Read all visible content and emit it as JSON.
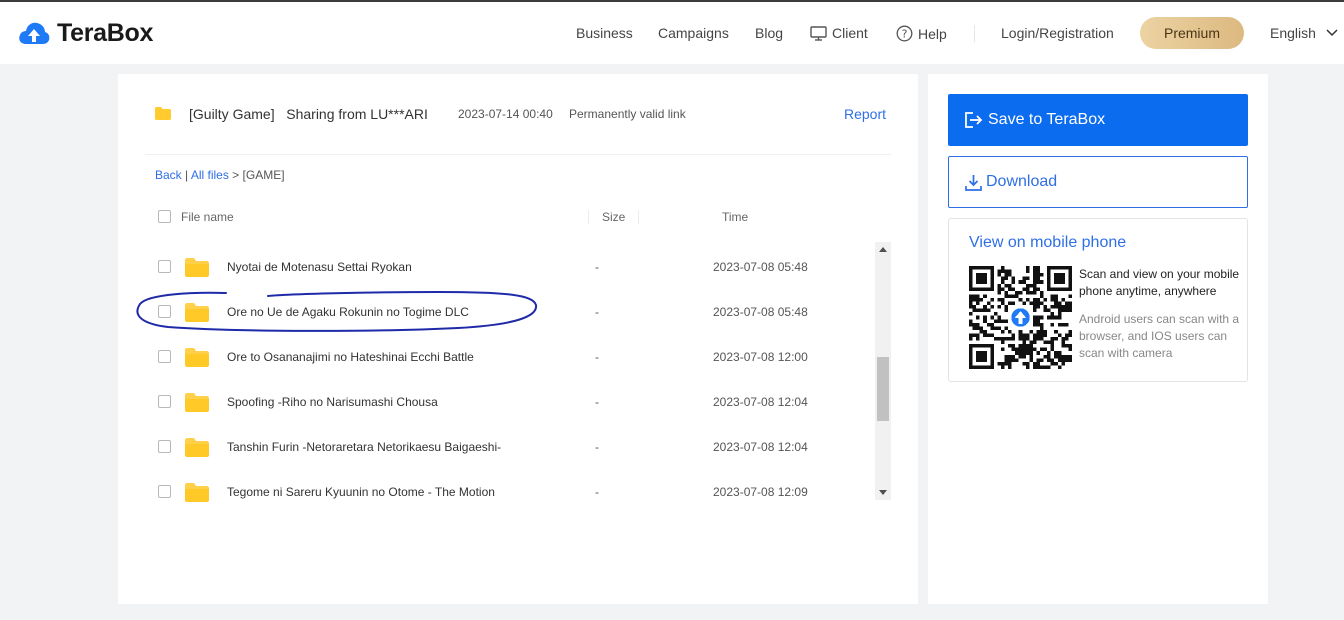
{
  "header": {
    "brand": "TeraBox",
    "nav": {
      "business": "Business",
      "campaigns": "Campaigns",
      "blog": "Blog",
      "client": "Client",
      "help": "Help",
      "login": "Login/Registration",
      "premium": "Premium",
      "language": "English"
    }
  },
  "share": {
    "title": "[Guilty Game]   Sharing from LU***ARI",
    "date": "2023-07-14 00:40",
    "validity": "Permanently valid link",
    "report": "Report"
  },
  "breadcrumb": {
    "back": "Back",
    "sep": "|",
    "all_files": "All files",
    "current": " > [GAME]"
  },
  "table": {
    "columns": {
      "name": "File name",
      "size": "Size",
      "time": "Time"
    },
    "rows": [
      {
        "name": "Nyotai de Motenasu Settai Ryokan",
        "size": "-",
        "time": "2023-07-08 05:48"
      },
      {
        "name": "Ore no Ue de Agaku Rokunin no Togime DLC",
        "size": "-",
        "time": "2023-07-08 05:48"
      },
      {
        "name": "Ore to Osananajimi no Hateshinai Ecchi Battle",
        "size": "-",
        "time": "2023-07-08 12:00"
      },
      {
        "name": "Spoofing -Riho no Narisumashi Chousa",
        "size": "-",
        "time": "2023-07-08 12:04"
      },
      {
        "name": "Tanshin Furin -Netoraretara Netorikaesu Baigaeshi-",
        "size": "-",
        "time": "2023-07-08 12:04"
      },
      {
        "name": "Tegome ni Sareru Kyuunin no Otome - The Motion",
        "size": "-",
        "time": "2023-07-08 12:09"
      }
    ]
  },
  "side": {
    "save": "Save to TeraBox",
    "download": "Download",
    "mobile_title": "View on mobile phone",
    "scan_main": "Scan and view on your mobile phone anytime, anywhere",
    "scan_sub": "Android users can scan with a browser, and IOS users can scan with camera"
  },
  "colors": {
    "accent": "#0b6cf0",
    "link": "#2e6fe6",
    "folder": "#ffd04a",
    "annotation": "#1f2aa8"
  }
}
